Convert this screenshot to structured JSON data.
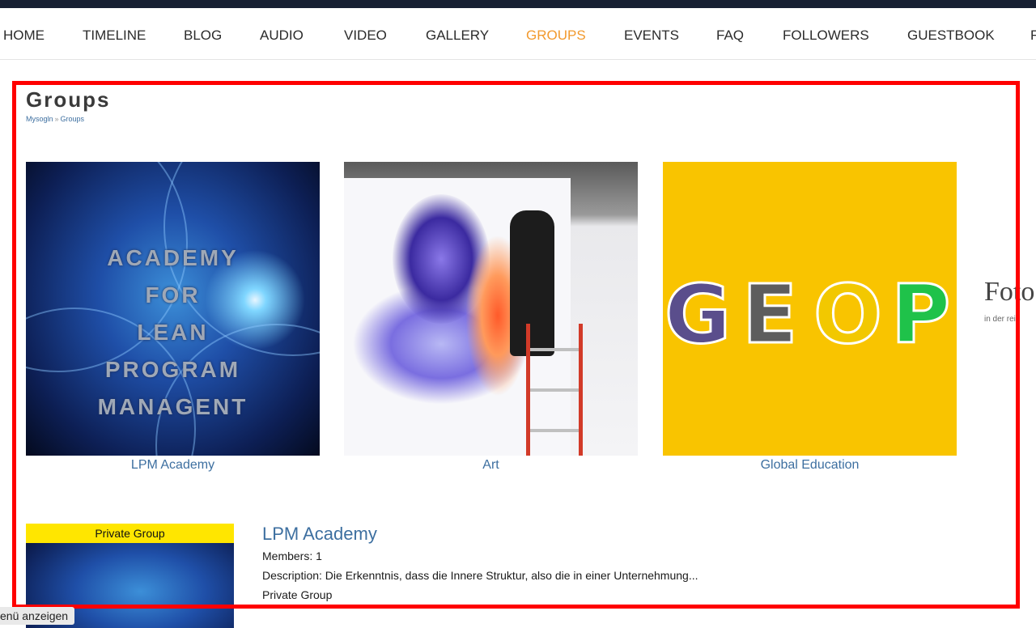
{
  "nav": {
    "items": [
      "HOME",
      "TIMELINE",
      "BLOG",
      "AUDIO",
      "VIDEO",
      "GALLERY",
      "GROUPS",
      "EVENTS",
      "FAQ",
      "FOLLOWERS",
      "GUESTBOOK",
      "F"
    ],
    "active": "GROUPS"
  },
  "page": {
    "title": "Groups",
    "breadcrumb": [
      "Mysogln",
      "Groups"
    ]
  },
  "tiles": [
    {
      "label": "LPM Academy",
      "image_text": [
        "ACADEMY",
        "FOR",
        "LEAN",
        "PROGRAM MANAGENT"
      ]
    },
    {
      "label": "Art"
    },
    {
      "label": "Global Education",
      "image_text": [
        "G",
        "E",
        "O",
        "P"
      ]
    }
  ],
  "partial_tile": {
    "title": "Foto",
    "subtitle": "in der reiz"
  },
  "group_list": [
    {
      "badge": "Private Group",
      "title": "LPM Academy",
      "members": "Members: 1",
      "description": "Description: Die Erkenntnis, dass die Innere Struktur, also die in einer Unternehmung...",
      "type": "Private Group"
    }
  ],
  "footer": {
    "menu_toggle": "enü anzeigen"
  },
  "colors": {
    "accent": "#f29a2e",
    "link": "#3d6fa0",
    "highlight": "#ff0000",
    "badge": "#ffe600",
    "geop_bg": "#f9c400"
  }
}
